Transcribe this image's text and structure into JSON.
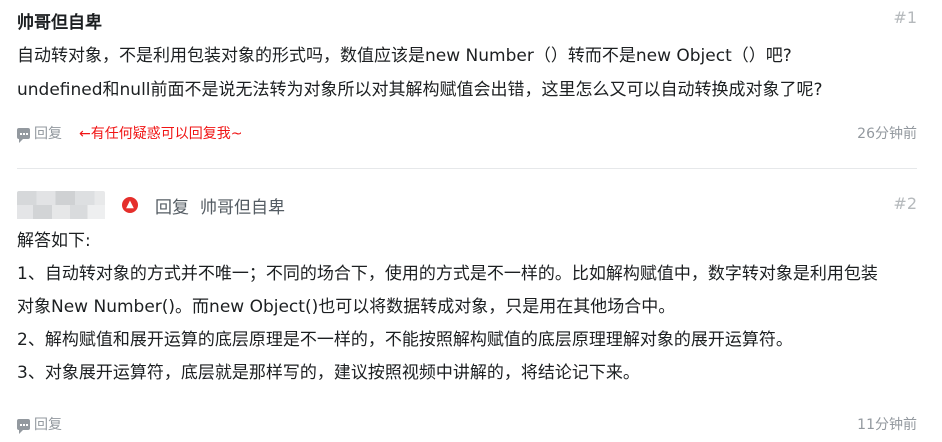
{
  "comments": [
    {
      "author": "帅哥但自卑",
      "floor": "#1",
      "lines": [
        "自动转对象，不是利用包装对象的形式吗，数值应该是new Number（）转而不是new Object（）吧?",
        "undefined和null前面不是说无法转为对象所以对其解构赋值会出错，这里怎么又可以自动转换成对象了呢?"
      ],
      "reply_label": "回复",
      "hint": "←有任何疑惑可以回复我~",
      "time": "26分钟前"
    },
    {
      "reply_label_top": "回复",
      "reply_target": "帅哥但自卑",
      "floor": "#2",
      "lines": [
        "解答如下:",
        "1、自动转对象的方式并不唯一；不同的场合下，使用的方式是不一样的。比如解构赋值中，数字转对象是利用包装",
        "对象New Number()。而new Object()也可以将数据转成对象，只是用在其他场合中。",
        "2、解构赋值和展开运算的底层原理是不一样的，不能按照解构赋值的底层原理理解对象的展开运算符。",
        "3、对象展开运算符，底层就是那样写的，建议按照视频中讲解的，将结论记下来。"
      ],
      "reply_label": "回复",
      "time": "11分钟前"
    }
  ],
  "icons": {
    "reply": "comment-bubble-icon",
    "badge": "flame-icon"
  },
  "colors": {
    "hint": "#f01414",
    "badge": "#e52f2b"
  }
}
